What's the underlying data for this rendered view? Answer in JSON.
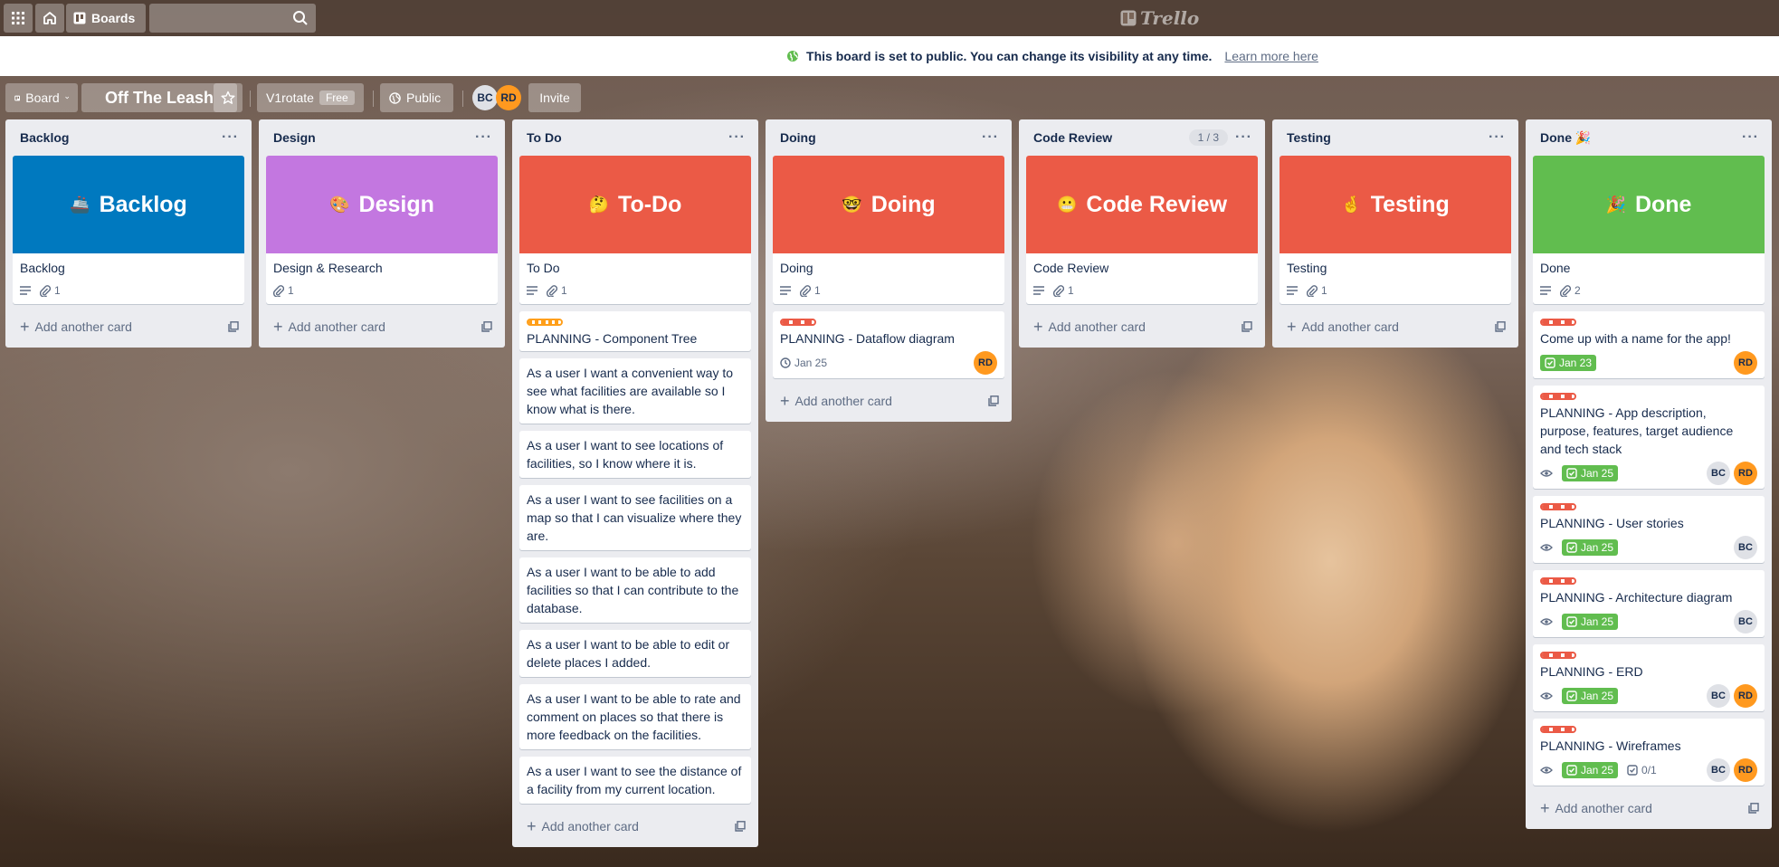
{
  "header": {
    "boards_label": "Boards",
    "search_placeholder": "",
    "logo_text": "Trello"
  },
  "banner": {
    "message": "This board is set to public. You can change its visibility at any time.",
    "learn_more": "Learn more here"
  },
  "board": {
    "view_label": "Board",
    "title": "Off The Leash",
    "team": "V1rotate",
    "plan": "Free",
    "visibility": "Public",
    "members": [
      "BC",
      "RD"
    ],
    "invite_label": "Invite"
  },
  "lists": [
    {
      "name": "Backlog",
      "add": "Add another card",
      "cover": {
        "emoji": "🚢",
        "text": "Backlog",
        "color": "#0079bf"
      },
      "cover_card": {
        "title": "Backlog",
        "attach": "1"
      }
    },
    {
      "name": "Design",
      "add": "Add another card",
      "cover": {
        "emoji": "🎨",
        "text": "Design",
        "color": "#c377e0"
      },
      "cover_card": {
        "title": "Design & Research",
        "attach": "1"
      }
    },
    {
      "name": "To Do",
      "add": "Add another card",
      "cover": {
        "emoji": "🤔",
        "text": "To-Do",
        "color": "#eb5a46"
      },
      "cover_card": {
        "title": "To Do",
        "attach": "1"
      },
      "cards": [
        "PLANNING - Component Tree",
        "As a user I want a convenient way to see what facilities are available so I know what is there.",
        "As a user I want to see locations of facilities, so I know where it is.",
        "As a user I want to see facilities on a map so that I can visualize where they are.",
        "As a user I want to be able to add facilities so that I can contribute to the database.",
        "As a user I want to be able to edit or delete places I added.",
        "As a user I want to be able to rate and comment on places so that there is more feedback on the facilities.",
        "As a user I want to see the distance of a facility from my current location."
      ]
    },
    {
      "name": "Doing",
      "add": "Add another card",
      "cover": {
        "emoji": "🤓",
        "text": "Doing",
        "color": "#eb5a46"
      },
      "cover_card": {
        "title": "Doing",
        "attach": "1"
      },
      "cards": [
        {
          "title": "PLANNING - Dataflow diagram",
          "date": "Jan 25",
          "member": "RD"
        }
      ]
    },
    {
      "name": "Code Review",
      "count": "1 / 3",
      "add": "Add another card",
      "cover": {
        "emoji": "😬",
        "text": "Code Review",
        "color": "#eb5a46"
      },
      "cover_card": {
        "title": "Code Review",
        "attach": "1"
      }
    },
    {
      "name": "Testing",
      "add": "Add another card",
      "cover": {
        "emoji": "🤞",
        "text": "Testing",
        "color": "#eb5a46"
      },
      "cover_card": {
        "title": "Testing",
        "attach": "1"
      }
    },
    {
      "name": "Done 🎉",
      "add": "Add another card",
      "cover": {
        "emoji": "🎉",
        "text": "Done",
        "color": "#61bd4f"
      },
      "cover_card": {
        "title": "Done",
        "attach": "2"
      },
      "cards": [
        {
          "title": "Come up with a name for the app!",
          "date": "Jan 23",
          "members": [
            "RD"
          ]
        },
        {
          "title": "PLANNING - App description, purpose, features, target audience and tech stack",
          "date": "Jan 25",
          "members": [
            "BC",
            "RD"
          ]
        },
        {
          "title": "PLANNING - User stories",
          "date": "Jan 25",
          "members": [
            "BC"
          ]
        },
        {
          "title": "PLANNING - Architecture diagram",
          "date": "Jan 25",
          "members": [
            "BC"
          ]
        },
        {
          "title": "PLANNING - ERD",
          "date": "Jan 25",
          "members": [
            "BC",
            "RD"
          ]
        },
        {
          "title": "PLANNING - Wireframes",
          "date": "Jan 25",
          "checklist": "0/1",
          "members": [
            "BC",
            "RD"
          ]
        }
      ]
    }
  ]
}
